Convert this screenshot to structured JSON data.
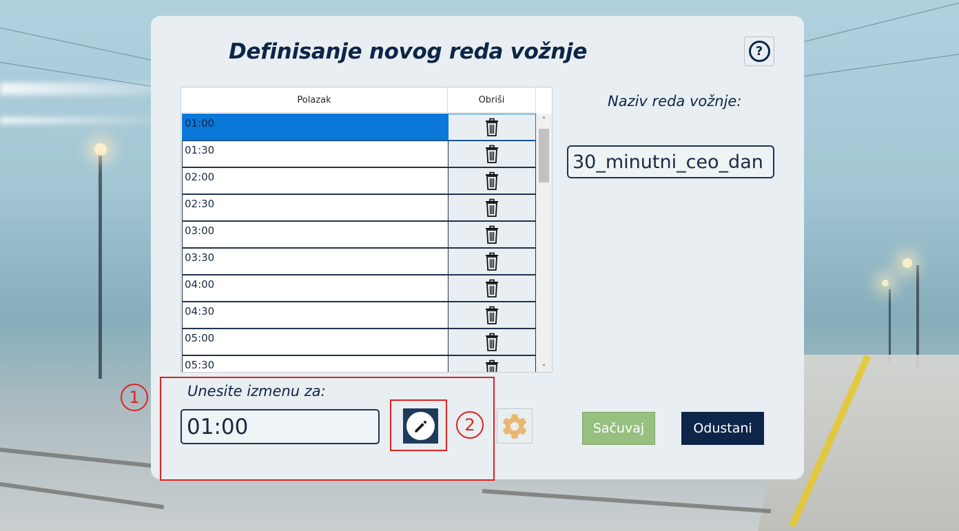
{
  "window": {
    "title": "Definisanje novog reda vožnje"
  },
  "help": {
    "label": "?"
  },
  "grid": {
    "columns": [
      "Polazak",
      "Obriši"
    ],
    "rows": [
      "01:00",
      "01:30",
      "02:00",
      "02:30",
      "03:00",
      "03:30",
      "04:00",
      "04:30",
      "05:00",
      "05:30"
    ],
    "selected_index": 0,
    "scroll_up": "˄",
    "scroll_down": "˅"
  },
  "schedule_name": {
    "label": "Naziv reda vožnje:",
    "value": "30_minutni_ceo_dan"
  },
  "edit": {
    "label": "Unesite izmenu za:",
    "value": "01:00"
  },
  "buttons": {
    "save": "Sačuvaj",
    "cancel": "Odustani"
  },
  "annotations": [
    "1",
    "2"
  ],
  "colors": {
    "primary": "#0d2548",
    "selection": "#0a78d8",
    "save": "#97bf7f",
    "annotation": "#e02020",
    "gear": "#e8b870"
  }
}
